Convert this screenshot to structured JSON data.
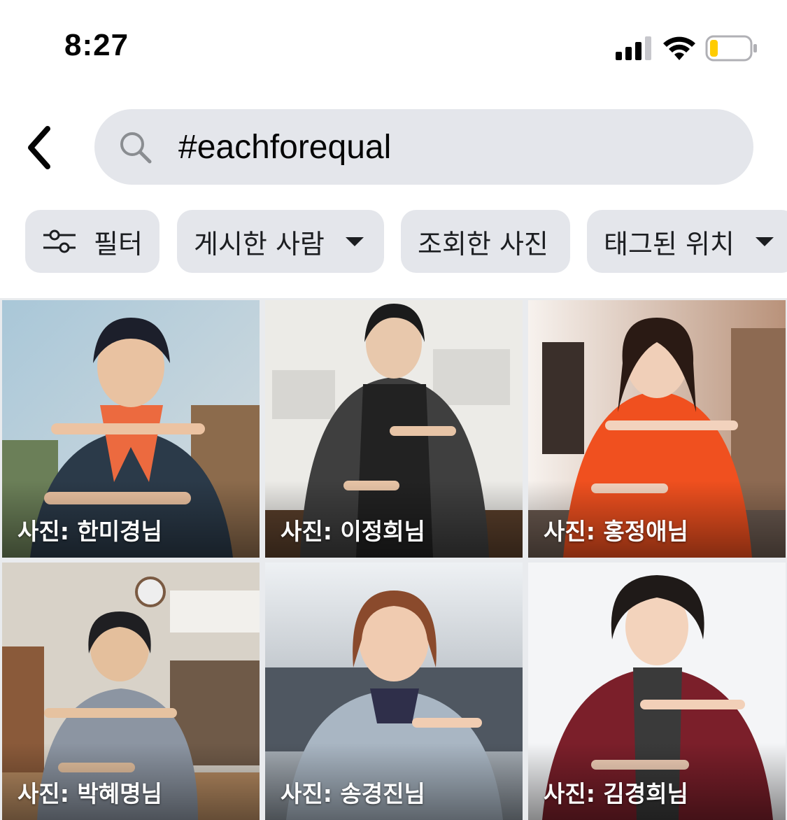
{
  "status_bar": {
    "time": "8:27"
  },
  "search": {
    "query": "#eachforequal"
  },
  "filters": [
    {
      "label": "필터",
      "icon": "sliders-icon"
    },
    {
      "label": "게시한 사람",
      "dropdown": true
    },
    {
      "label": "조회한 사진"
    },
    {
      "label": "태그된 위치",
      "dropdown": true
    }
  ],
  "photos": [
    {
      "caption": "사진: 한미경님",
      "top_color": "#7c3b2a"
    },
    {
      "caption": "사진: 이정희님",
      "top_color": "#2b2b2b"
    },
    {
      "caption": "사진: 홍정애님",
      "top_color": "#f04a22"
    },
    {
      "caption": "사진: 박혜명님",
      "top_color": "#8d98a6"
    },
    {
      "caption": "사진: 송경진님",
      "top_color": "#a9b4c0"
    },
    {
      "caption": "사진: 김경희님",
      "top_color": "#7b1f2a"
    }
  ]
}
